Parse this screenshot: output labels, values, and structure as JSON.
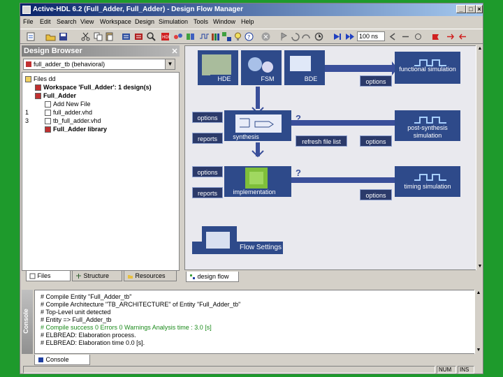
{
  "window": {
    "title": "Active-HDL 6.2 (Full_Adder, Full_Adder) - Design Flow Manager",
    "controls": [
      "_",
      "□",
      "×"
    ]
  },
  "menu": [
    "File",
    "Edit",
    "Search",
    "View",
    "Workspace",
    "Design",
    "Simulation",
    "Tools",
    "Window",
    "Help"
  ],
  "toolbar": {
    "zoom_value": "100 ns"
  },
  "design_browser": {
    "title": "Design Browser",
    "combo_value": "full_adder_tb (behavioral)",
    "tree": [
      {
        "indent": 0,
        "num": "",
        "label": "Files dd",
        "bold": false
      },
      {
        "indent": 1,
        "num": "",
        "label": "Workspace 'Full_Adder': 1 design(s)",
        "bold": true
      },
      {
        "indent": 1,
        "num": "",
        "label": "Full_Adder",
        "bold": true
      },
      {
        "indent": 2,
        "num": "",
        "label": "Add New File",
        "bold": false
      },
      {
        "indent": 2,
        "num": "1",
        "label": "full_adder.vhd",
        "bold": false
      },
      {
        "indent": 2,
        "num": "3",
        "label": "tb_full_adder.vhd",
        "bold": false
      },
      {
        "indent": 2,
        "num": "",
        "label": "Full_Adder library",
        "bold": true
      }
    ],
    "tabs": [
      "Files",
      "Structure",
      "Resources"
    ]
  },
  "flow": {
    "entry_tools": [
      "HDE",
      "FSM",
      "BDE"
    ],
    "labels": {
      "options_top": "options",
      "functional_sim": "functional simulation",
      "options_synth": "options",
      "reports_synth": "reports",
      "synthesis": "synthesis",
      "refresh": "refresh file list",
      "options_post": "options",
      "post_synth_sim": "post-synthesis simulation",
      "options_impl": "options",
      "reports_impl": "reports",
      "implementation": "implementation",
      "options_timing": "options",
      "timing_sim": "timing simulation",
      "flow_settings": "Flow Settings",
      "q1": "?",
      "q2": "?"
    },
    "tab": "design flow"
  },
  "console": {
    "side_label": "Console",
    "tab": "Console",
    "lines": [
      {
        "text": "# Compile Entity \"Full_Adder_tb\"",
        "color": "#000000"
      },
      {
        "text": "# Compile Architecture \"TB_ARCHITECTURE\" of Entity \"Full_Adder_tb\"",
        "color": "#000000"
      },
      {
        "text": "# Top-Level unit detected",
        "color": "#000000"
      },
      {
        "text": "# Entity => Full_Adder_tb",
        "color": "#000000"
      },
      {
        "text": "# Compile success 0 Errors 0 Warnings  Analysis time : 3.0 [s]",
        "color": "#1a8a1a"
      },
      {
        "text": "# ELBREAD: Elaboration process.",
        "color": "#000000"
      },
      {
        "text": "# ELBREAD: Elaboration time 0.0 [s].",
        "color": "#000000"
      }
    ]
  },
  "status": {
    "num": "NUM",
    "ins": "INS"
  },
  "colors": {
    "desktop": "#1e9a2c",
    "title_start": "#0a246a",
    "flow_bg": "#e9e9ee",
    "flow_arrow": "#3a4f9a"
  }
}
